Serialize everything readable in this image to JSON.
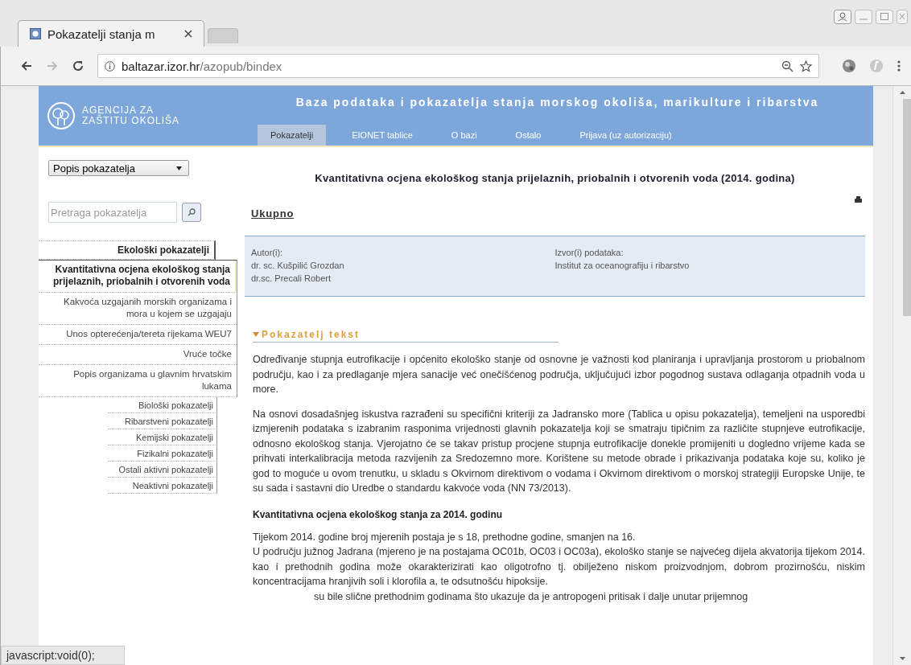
{
  "browser": {
    "tab_title": "Pokazatelji stanja m",
    "url_host": "baltazar.izor.hr",
    "url_path": "/azopub/bindex"
  },
  "header": {
    "logo_line1": "AGENCIJA ZA",
    "logo_line2": "ZAŠTITU OKOLIŠA",
    "title": "Baza podataka i pokazatelja stanja morskog okoliša, marikulture i ribarstva",
    "nav": [
      {
        "label": "Pokazatelji",
        "selected": true
      },
      {
        "label": "EIONET tablice",
        "selected": false
      },
      {
        "label": "O bazi",
        "selected": false
      },
      {
        "label": "Ostalo",
        "selected": false
      },
      {
        "label": "Prijava (uz autorizaciju)",
        "selected": false
      }
    ]
  },
  "sidebar": {
    "dropdown": "Popis pokazatelja",
    "search_placeholder": "Pretraga pokazatelja",
    "categories": [
      {
        "label": "Ekološki pokazatelji",
        "selected": true,
        "children": [
          {
            "label": "Kvantitativna ocjena ekološkog stanja prijelaznih, priobalnih i otvorenih voda",
            "selected": true
          },
          {
            "label": "Kakvoća uzgajanih morskih organizama i mora u kojem se uzgajaju",
            "selected": false
          },
          {
            "label": "Unos opterećenja/tereta rijekama WEU7",
            "selected": false
          },
          {
            "label": "Vruće točke",
            "selected": false
          },
          {
            "label": "Popis organizama u glavnim hrvatskim lukama",
            "selected": false
          }
        ]
      },
      {
        "label": "Biološki pokazatelji",
        "selected": false
      },
      {
        "label": "Ribarstveni pokazatelji",
        "selected": false
      },
      {
        "label": "Kemijski pokazatelji",
        "selected": false
      },
      {
        "label": "Fizikalni pokazatelji",
        "selected": false
      },
      {
        "label": "Ostali aktivni pokazatelji",
        "selected": false
      },
      {
        "label": "Neaktivni pokazatelji",
        "selected": false
      }
    ]
  },
  "main": {
    "title": "Kvantitativna ocjena ekološkog stanja prijelaznih, priobalnih i otvorenih voda (2014. godina)",
    "subtitle": "Ukupno",
    "authors_label": "Autor(i):",
    "authors": [
      "dr. sc. Kušpilić Grozdan",
      "dr.sc. Precali Robert"
    ],
    "source_label": "Izvor(i) podataka:",
    "source": "Institut za oceanografiju i ribarstvo",
    "section_title": "Pokazatelj tekst",
    "paragraphs": [
      "Određivanje stupnja eutrofikacije i općenito ekološko stanje od osnovne je važnosti kod planiranja i upravljanja prostorom u priobalnom području, kao i za predlaganje mjera sanacije već onečišćenog područja, uključujući izbor pogodnog sustava odlaganja otpadnih voda u more.",
      "Na osnovi dosadašnjeg iskustva razrađeni su specifični kriteriji za Jadransko more (Tablica u opisu pokazatelja), temeljeni na usporedbi izmjerenih podataka s izabranim rasponima vrijednosti glavnih pokazatelja koji se smatraju tipičnim za različite stupnjeve eutrofikacije, odnosno ekološkog stanja. Vjerojatno će se takav pristup procjene stupnja eutrofikacije donekle promijeniti u dogledno vrijeme kada se prihvati interkalibracija metoda razvijenih za Sredozemno more. Korištene su metode obrade i prikazivanja podataka koje su, koliko je god to moguće u ovom trenutku, u skladu s Okvirnom direktivom o vodama i Okvirnom direktivom o morskoj strategiji Europske Unije, te su sada i sastavni dio Uredbe o standardu kakvoće voda (NN 73/2013)."
    ],
    "subheading": "Kvantitativna ocjena ekološkog stanja za 2014. godinu",
    "lines": [
      "Tijekom 2014. godine broj mjerenih postaja je s 18, prethodne godine, smanjen na 16.",
      "U području južnog Jadrana (mjereno je na postajama OC01b, OC03 i OC03a), ekološko stanje se najvećeg dijela akvatorija tijekom 2014. kao i prethodnih godina može okarakterizirati kao oligotrofno tj. obilježeno niskom proizvodnjom, dobrom prozirnošću, niskim koncentracijama hranjivih soli i klorofila a, te odsutnošću hipoksije."
    ],
    "partial_line": "su bile slične prethodnim godinama što ukazuje da je antropogeni pritisak i dalje unutar prijemnog"
  },
  "status_bar": "javascript:void(0);"
}
